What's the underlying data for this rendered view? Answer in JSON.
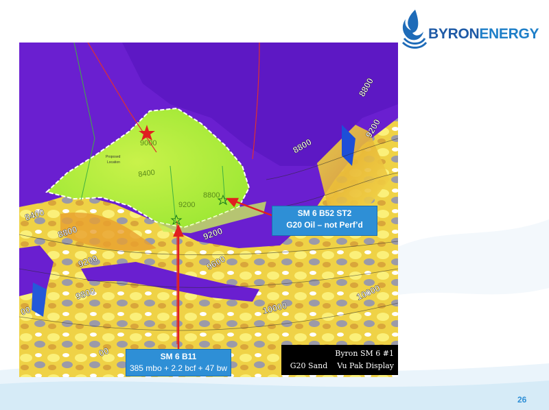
{
  "logo": {
    "brand_primary": "BYRON",
    "brand_secondary": "ENERGY",
    "color": "#1e5aa6"
  },
  "seismic": {
    "contours": {
      "c8400_left": "8400",
      "c8800_left": "8800",
      "c9200_left": "9200",
      "c9600_left": "9600",
      "c9800_top": "9800",
      "c8400_top": "8400",
      "c9200_mid": "9200",
      "c9600_mid": "9600",
      "c10000_mid": "10000",
      "c10000_right": "10000",
      "c8800_right": "8800",
      "c9200_right": "9200",
      "c8800_far": "8800",
      "c9000_top": "9000",
      "c8800_small": "8800",
      "c9200_small": "9200",
      "c00_left": "00",
      "c00_bottom": "00"
    },
    "proposed_location": [
      "Proposed",
      "Location"
    ],
    "colors": {
      "purple": "#6a1fd0",
      "lime": "#b8f53a",
      "yellow": "#f5dc3a",
      "red_marker": "#e02020"
    }
  },
  "callouts": {
    "b52": {
      "title": "SM 6 B52 ST2",
      "subtitle": "G20 Oil – not Perf’d"
    },
    "b11": {
      "title": "SM 6 B11",
      "subtitle": "385 mbo + 2.2 bcf + 47 bw"
    }
  },
  "legend": {
    "line1": "Byron SM 6 #1",
    "line2": "G20 Sand    Vu Pak Display"
  },
  "page": {
    "number": "26"
  }
}
